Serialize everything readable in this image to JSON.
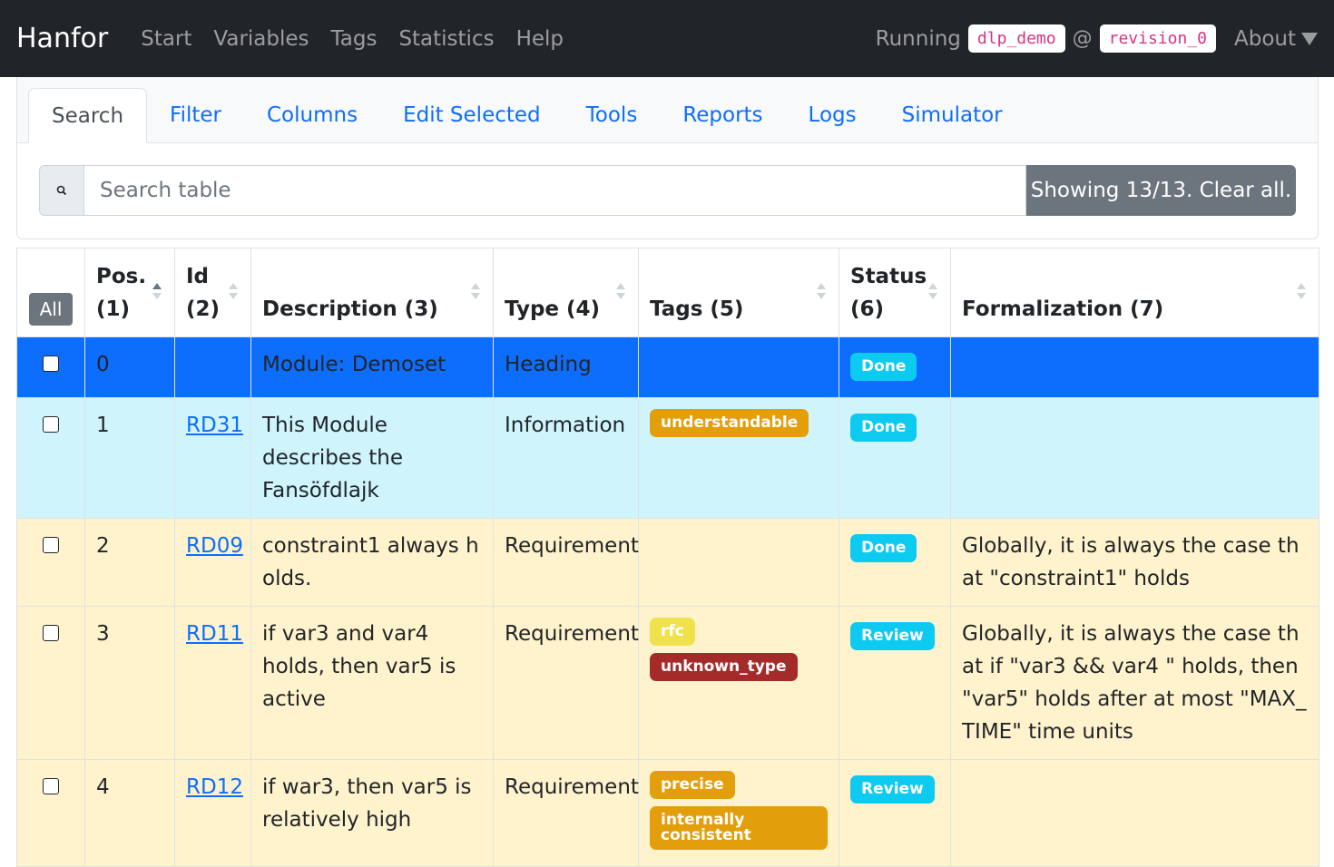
{
  "navbar": {
    "brand": "Hanfor",
    "links": [
      "Start",
      "Variables",
      "Tags",
      "Statistics",
      "Help"
    ],
    "running_label": "Running",
    "project": "dlp_demo",
    "at": "@",
    "revision": "revision_0",
    "about": "About"
  },
  "tabs": [
    "Search",
    "Filter",
    "Columns",
    "Edit Selected",
    "Tools",
    "Reports",
    "Logs",
    "Simulator"
  ],
  "search": {
    "placeholder": "Search table",
    "clear_label": "Showing 13/13. Clear all."
  },
  "table": {
    "select_all_label": "All",
    "headers": {
      "pos": "Pos. (1)",
      "id": "Id (2)",
      "description": "Description (3)",
      "type": "Type (4)",
      "tags": "Tags (5)",
      "status": "Status (6)",
      "formalization": "Formalization (7)"
    },
    "rows": [
      {
        "pos": "0",
        "id": "",
        "description": "Module: Demoset",
        "type": "Heading",
        "tags": [],
        "status": "Done",
        "formalization": ""
      },
      {
        "pos": "1",
        "id": "RD31",
        "description": "This Module describes the Fansöfdlajk",
        "type": "Information",
        "tags": [
          {
            "label": "understandable",
            "color": "#e39e0b"
          }
        ],
        "status": "Done",
        "formalization": ""
      },
      {
        "pos": "2",
        "id": "RD09",
        "description": "constraint1 always holds.",
        "type": "Requirement",
        "tags": [],
        "status": "Done",
        "formalization": "Globally, it is always the case that \"constraint1\" holds"
      },
      {
        "pos": "3",
        "id": "RD11",
        "description": "if var3 and var4 holds, then var5 is active",
        "type": "Requirement",
        "tags": [
          {
            "label": "rfc",
            "color": "#f0e24c"
          },
          {
            "label": "unknown_type",
            "color": "#a52a2a"
          }
        ],
        "status": "Review",
        "formalization": "Globally, it is always the case that if \"var3 && var4 \" holds, then \"var5\" holds after at most \"MAX_TIME\" time units"
      },
      {
        "pos": "4",
        "id": "RD12",
        "description": "if war3, then var5 is relatively high",
        "type": "Requirement",
        "tags": [
          {
            "label": "precise",
            "color": "#e39e0b"
          },
          {
            "label": "internally consistent",
            "color": "#e39e0b"
          }
        ],
        "status": "Review",
        "formalization": ""
      }
    ]
  },
  "colors": {
    "navbar_bg": "#212529",
    "primary": "#0d6efd",
    "info_row": "#cff4fc",
    "warning_row": "#fff3cd",
    "status_badge": "#0dcaf0"
  }
}
